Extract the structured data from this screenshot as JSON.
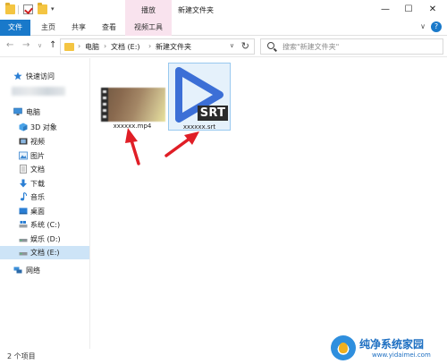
{
  "titlebar": {
    "context_tab_group": "播放",
    "window_title": "新建文件夹",
    "quick_access_dropdown": "▾",
    "minimize": "—",
    "maximize": "☐",
    "close": "✕"
  },
  "ribbon": {
    "tabs": [
      "文件",
      "主页",
      "共享",
      "查看",
      "视频工具"
    ],
    "collapse_glyph": "∨",
    "help_glyph": "?"
  },
  "address": {
    "breadcrumbs": [
      "电脑",
      "文档 (E:)",
      "新建文件夹"
    ],
    "separator": "›",
    "search_placeholder": "搜索\"新建文件夹\""
  },
  "nav_arrows": {
    "back": "←",
    "forward": "→",
    "recent": "∨",
    "up": "↑"
  },
  "nav_pane": {
    "quick_access": "快速访问",
    "this_pc": "电脑",
    "items": [
      "3D 对象",
      "视频",
      "图片",
      "文档",
      "下载",
      "音乐",
      "桌面",
      "系统 (C:)",
      "娱乐 (D:)",
      "文档 (E:)"
    ],
    "network": "网络",
    "selected_item": "文档 (E:)"
  },
  "files": [
    {
      "name": "xxxxxx.mp4",
      "type": "video",
      "icon": "video-thumbnail"
    },
    {
      "name": "xxxxxx.srt",
      "type": "subtitle",
      "icon": "srt-play-icon",
      "badge": "SRT"
    }
  ],
  "status": {
    "item_count": "2 个项目"
  },
  "watermark": {
    "title": "纯净系统家园",
    "url": "www.yidaimei.com"
  },
  "colors": {
    "accent_blue": "#1979ca",
    "context_tab_pink": "#f9e3ee",
    "selection_blue": "#cde4f7",
    "annotation_red": "#e01e26",
    "srt_play_blue": "#3c6fd6"
  }
}
